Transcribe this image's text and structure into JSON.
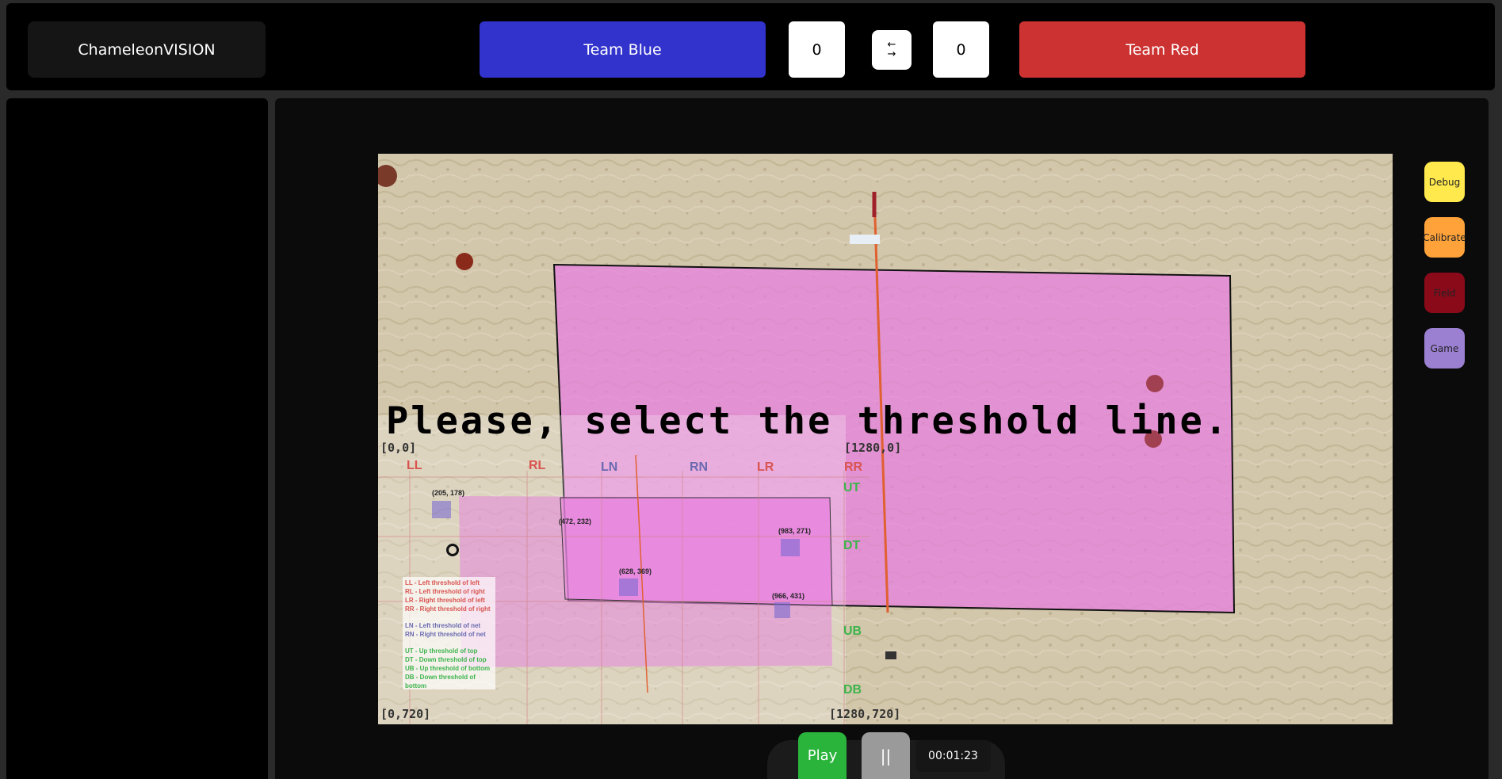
{
  "app": {
    "brand": "ChameleonVISION"
  },
  "teams": {
    "blue": "Team Blue",
    "red": "Team Red",
    "blue_score": "0",
    "red_score": "0"
  },
  "swap": {
    "icon": "swap-arrows-icon",
    "top": "←",
    "bottom": "→"
  },
  "video": {
    "prompt": "Please, select the threshold line.",
    "corners": {
      "tl": "[0,0]",
      "tr": "[1280,0]",
      "bl": "[0,720]",
      "br": "[1280,720]"
    },
    "threshold_labels": {
      "ll": "LL",
      "rl": "RL",
      "ln": "LN",
      "rn": "RN",
      "lr": "LR",
      "rr": "RR",
      "ut": "UT",
      "dt": "DT",
      "ub": "UB",
      "db": "DB"
    },
    "points": [
      "(205, 178)",
      "(472, 232)",
      "(628, 369)",
      "(983, 271)",
      "(966, 431)"
    ],
    "legend": [
      {
        "text": "LL - Left threshold of left",
        "color": "#d9534f"
      },
      {
        "text": "RL - Left threshold of right",
        "color": "#d9534f"
      },
      {
        "text": "LR - Right threshold of left",
        "color": "#d9534f"
      },
      {
        "text": "RR - Right threshold of right",
        "color": "#d9534f"
      },
      {
        "text": "LN - Left threshold of net",
        "color": "#6a6ab0"
      },
      {
        "text": "RN - Right threshold of net",
        "color": "#6a6ab0"
      },
      {
        "text": "UT - Up threshold of top",
        "color": "#3cb44b"
      },
      {
        "text": "DT - Down threshold of top",
        "color": "#3cb44b"
      },
      {
        "text": "UB - Up threshold of bottom",
        "color": "#3cb44b"
      },
      {
        "text": "DB - Down threshold of bottom",
        "color": "#3cb44b"
      }
    ],
    "court_color": "#e87ee0"
  },
  "side_buttons": {
    "debug": "Debug",
    "calibrate": "Calibrate",
    "field": "Field",
    "game": "Game"
  },
  "side_colors": {
    "debug": "#ffe94d",
    "calibrate": "#ffa23a",
    "field": "#8b0a1a",
    "game": "#9b7fd1"
  },
  "playback": {
    "play": "Play",
    "pause": "||",
    "time": "00:01:23"
  }
}
